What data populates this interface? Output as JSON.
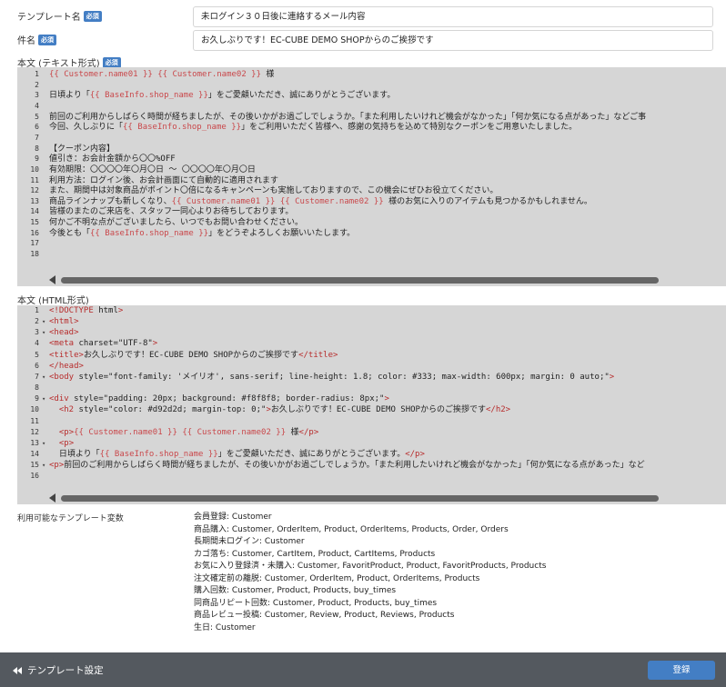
{
  "form": {
    "template_name": {
      "label": "テンプレート名",
      "badge": "必須",
      "value": "未ログイン３０日後に連絡するメール内容"
    },
    "subject": {
      "label": "件名",
      "badge": "必須",
      "value": "お久しぶりです！EC-CUBE DEMO SHOPからのご挨拶です"
    },
    "body_text": {
      "label": "本文 (テキスト形式)",
      "badge": "必須",
      "lines": [
        {
          "n": "1",
          "text": "{{ Customer.name01 }} {{ Customer.name02 }} 様"
        },
        {
          "n": "2",
          "text": ""
        },
        {
          "n": "3",
          "text": "日頃より「{{ BaseInfo.shop_name }}」をご愛顧いただき、誠にありがとうございます。"
        },
        {
          "n": "4",
          "text": ""
        },
        {
          "n": "5",
          "text": "前回のご利用からしばらく時間が経ちましたが、その後いかがお過ごしでしょうか。「また利用したいけれど機会がなかった」「何か気になる点があった」などご事"
        },
        {
          "n": "6",
          "text": "今回、久しぶりに「{{ BaseInfo.shop_name }}」をご利用いただく皆様へ、感謝の気持ちを込めて特別なクーポンをご用意いたしました。"
        },
        {
          "n": "7",
          "text": ""
        },
        {
          "n": "8",
          "text": "【クーポン内容】"
        },
        {
          "n": "9",
          "text": "値引き：お会計金額から〇〇%OFF"
        },
        {
          "n": "10",
          "text": "有効期限：〇〇〇〇年〇月〇日 ～ 〇〇〇〇年〇月〇日"
        },
        {
          "n": "11",
          "text": "利用方法：ログイン後、お会計画面にて自動的に適用されます"
        },
        {
          "n": "12",
          "text": "また、期間中は対象商品がポイント〇倍になるキャンペーンも実施しておりますので、この機会にぜひお役立てください。"
        },
        {
          "n": "13",
          "text": "商品ラインナップも新しくなり、{{ Customer.name01 }} {{ Customer.name02 }} 様のお気に入りのアイテムも見つかるかもしれません。"
        },
        {
          "n": "14",
          "text": "皆様のまたのご来店を、スタッフ一同心よりお待ちしております。"
        },
        {
          "n": "15",
          "text": "何かご不明な点がございましたら、いつでもお問い合わせください。"
        },
        {
          "n": "16",
          "text": "今後とも「{{ BaseInfo.shop_name }}」をどうぞよろしくお願いいたします。"
        },
        {
          "n": "17",
          "text": ""
        },
        {
          "n": "18",
          "text": ""
        }
      ]
    },
    "body_html": {
      "label": "本文 (HTML形式)",
      "lines": [
        {
          "n": "1",
          "fold": false,
          "text": "<!DOCTYPE html>"
        },
        {
          "n": "2",
          "fold": true,
          "text": "<html>"
        },
        {
          "n": "3",
          "fold": true,
          "text": "<head>"
        },
        {
          "n": "4",
          "fold": false,
          "text": "<meta charset=\"UTF-8\">"
        },
        {
          "n": "5",
          "fold": false,
          "text": "<title>お久しぶりです！EC-CUBE DEMO SHOPからのご挨拶です</title>"
        },
        {
          "n": "6",
          "fold": false,
          "text": "</head>"
        },
        {
          "n": "7",
          "fold": true,
          "text": "<body style=\"font-family: 'メイリオ', sans-serif; line-height: 1.8; color: #333; max-width: 600px; margin: 0 auto;\">"
        },
        {
          "n": "8",
          "fold": false,
          "text": ""
        },
        {
          "n": "9",
          "fold": true,
          "text": "<div style=\"padding: 20px; background: #f8f8f8; border-radius: 8px;\">"
        },
        {
          "n": "10",
          "fold": false,
          "text": "  <h2 style=\"color: #d92d2d; margin-top: 0;\">お久しぶりです！EC-CUBE DEMO SHOPからのご挨拶です</h2>"
        },
        {
          "n": "11",
          "fold": false,
          "text": ""
        },
        {
          "n": "12",
          "fold": false,
          "text": "  <p>{{ Customer.name01 }} {{ Customer.name02 }} 様</p>"
        },
        {
          "n": "13",
          "fold": true,
          "text": "  <p>"
        },
        {
          "n": "14",
          "fold": false,
          "text": "  日頃より「{{ BaseInfo.shop_name }}」をご愛顧いただき、誠にありがとうございます。</p>"
        },
        {
          "n": "15",
          "fold": true,
          "text": "<p>前回のご利用からしばらく時間が経ちましたが、その後いかがお過ごしでしょうか。「また利用したいけれど機会がなかった」「何か気になる点があった」など"
        },
        {
          "n": "16",
          "fold": false,
          "text": ""
        }
      ]
    },
    "variables": {
      "label": "利用可能なテンプレート変数",
      "items": [
        "会員登録: Customer",
        "商品購入: Customer, OrderItem, Product, OrderItems, Products, Order, Orders",
        "長期間未ログイン: Customer",
        "カゴ落ち: Customer, CartItem, Product, CartItems, Products",
        "お気に入り登録済・未購入: Customer, FavoritProduct, Product, FavoritProducts, Products",
        "注文確定前の離脱: Customer, OrderItem, Product, OrderItems, Products",
        "購入回数: Customer, Product, Products, buy_times",
        "同商品リピート回数: Customer, Product, Products, buy_times",
        "商品レビュー投稿: Customer, Review, Product, Reviews, Products",
        "生日: Customer"
      ]
    }
  },
  "footer": {
    "back_label": "テンプレート設定",
    "submit_label": "登録"
  },
  "colors": {
    "accent": "#437ec4",
    "footer_bg": "#54595f",
    "editor_bg": "#d6d6d6",
    "template_token": "#c9484b"
  }
}
